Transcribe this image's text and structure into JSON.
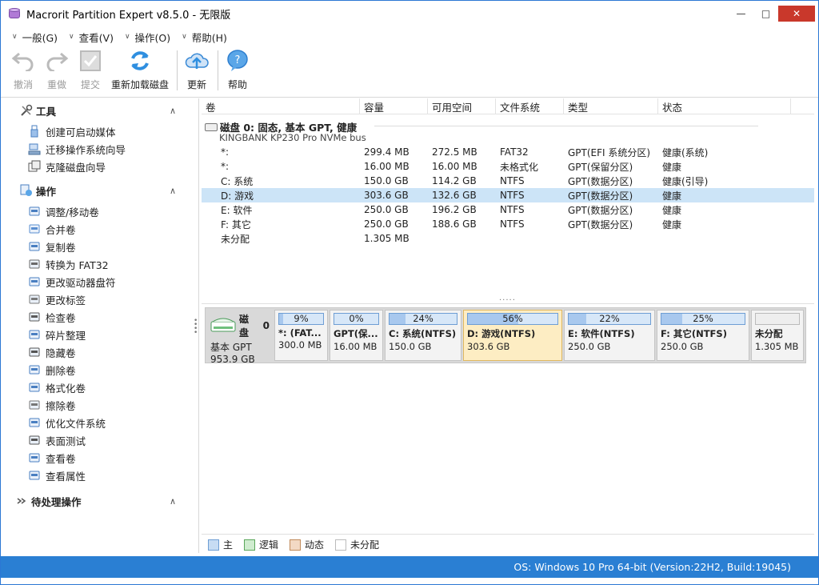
{
  "window": {
    "title": "Macrorit Partition Expert v8.5.0 - 无限版"
  },
  "menu": [
    {
      "label": "一般(G)"
    },
    {
      "label": "查看(V)"
    },
    {
      "label": "操作(O)"
    },
    {
      "label": "帮助(H)"
    }
  ],
  "toolbar": {
    "undo": "撤消",
    "redo": "重做",
    "commit": "提交",
    "reload": "重新加载磁盘",
    "update": "更新",
    "help": "帮助"
  },
  "sidebar": {
    "tools_title": "工具",
    "tools": [
      {
        "label": "创建可启动媒体",
        "icon": "usb-icon"
      },
      {
        "label": "迁移操作系统向导",
        "icon": "migrate-icon"
      },
      {
        "label": "克隆磁盘向导",
        "icon": "clone-icon"
      }
    ],
    "ops_title": "操作",
    "ops": [
      {
        "label": "调整/移动卷",
        "icon": "resize-icon"
      },
      {
        "label": "合并卷",
        "icon": "merge-icon"
      },
      {
        "label": "复制卷",
        "icon": "copy-icon"
      },
      {
        "label": "转换为 FAT32",
        "icon": "convert-icon"
      },
      {
        "label": "更改驱动器盘符",
        "icon": "drive-letter-icon"
      },
      {
        "label": "更改标签",
        "icon": "label-icon"
      },
      {
        "label": "检查卷",
        "icon": "wrench-icon"
      },
      {
        "label": "碎片整理",
        "icon": "defrag-icon"
      },
      {
        "label": "隐藏卷",
        "icon": "eye-icon"
      },
      {
        "label": "删除卷",
        "icon": "delete-icon"
      },
      {
        "label": "格式化卷",
        "icon": "format-icon"
      },
      {
        "label": "擦除卷",
        "icon": "eraser-icon"
      },
      {
        "label": "优化文件系统",
        "icon": "optimize-icon"
      },
      {
        "label": "表面测试",
        "icon": "search-icon"
      },
      {
        "label": "查看卷",
        "icon": "view-icon"
      },
      {
        "label": "查看属性",
        "icon": "properties-icon"
      }
    ],
    "pending_title": "待处理操作"
  },
  "table": {
    "headers": [
      "卷",
      "容量",
      "可用空间",
      "文件系统",
      "类型",
      "状态"
    ],
    "disk_title": "磁盘  0: 固态, 基本 GPT, 健康",
    "disk_model": "KINGBANK KP230 Pro NVMe bus",
    "rows": [
      {
        "vol": "*:",
        "cap": "299.4 MB",
        "free": "272.5 MB",
        "fs": "FAT32",
        "type": "GPT(EFI 系统分区)",
        "status": "健康(系统)"
      },
      {
        "vol": "*:",
        "cap": "16.00 MB",
        "free": "16.00 MB",
        "fs": "未格式化",
        "type": "GPT(保留分区)",
        "status": "健康"
      },
      {
        "vol": "C: 系统",
        "cap": "150.0 GB",
        "free": "114.2 GB",
        "fs": "NTFS",
        "type": "GPT(数据分区)",
        "status": "健康(引导)"
      },
      {
        "vol": "D: 游戏",
        "cap": "303.6 GB",
        "free": "132.6 GB",
        "fs": "NTFS",
        "type": "GPT(数据分区)",
        "status": "健康"
      },
      {
        "vol": "E: 软件",
        "cap": "250.0 GB",
        "free": "196.2 GB",
        "fs": "NTFS",
        "type": "GPT(数据分区)",
        "status": "健康"
      },
      {
        "vol": "F: 其它",
        "cap": "250.0 GB",
        "free": "188.6 GB",
        "fs": "NTFS",
        "type": "GPT(数据分区)",
        "status": "健康"
      },
      {
        "vol": "未分配",
        "cap": "1.305 MB",
        "free": "",
        "fs": "",
        "type": "",
        "status": ""
      }
    ],
    "splitter": "....."
  },
  "diskmap": {
    "disk_label": "磁盘",
    "disk_num": "0",
    "disk_type": "基本 GPT",
    "disk_size": "953.9 GB",
    "parts": [
      {
        "pct": "9%",
        "fill": 9,
        "name": "*: (FAT...",
        "size": "300.0 MB"
      },
      {
        "pct": "0%",
        "fill": 0,
        "name": "GPT(保...",
        "size": "16.00 MB"
      },
      {
        "pct": "24%",
        "fill": 24,
        "name": "C: 系统(NTFS)",
        "size": "150.0 GB"
      },
      {
        "pct": "56%",
        "fill": 56,
        "name": "D: 游戏(NTFS)",
        "size": "303.6 GB"
      },
      {
        "pct": "22%",
        "fill": 22,
        "name": "E: 软件(NTFS)",
        "size": "250.0 GB"
      },
      {
        "pct": "25%",
        "fill": 25,
        "name": "F: 其它(NTFS)",
        "size": "250.0 GB"
      },
      {
        "pct": "",
        "fill": 0,
        "name": "未分配",
        "size": "1.305 MB"
      }
    ]
  },
  "legend": [
    "主",
    "逻辑",
    "动态",
    "未分配"
  ],
  "status": "OS: Windows 10 Pro 64-bit (Version:22H2, Build:19045)",
  "colors": {
    "accent": "#2a7fd3",
    "selected_row": "#cce4f7",
    "selected_part": "#fdedc3",
    "close": "#c9382b"
  }
}
